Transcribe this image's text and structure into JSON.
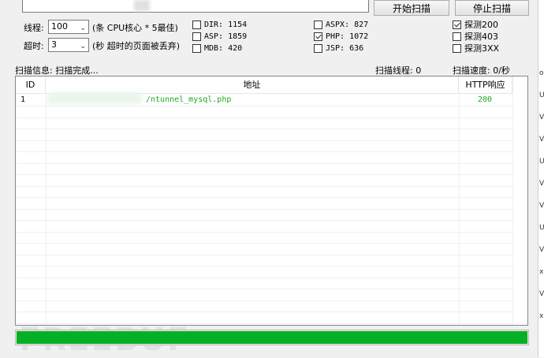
{
  "toolbar": {
    "start_label": "开始扫描",
    "stop_label": "停止扫描"
  },
  "options": {
    "threads_label": "线程:",
    "threads_value": "100",
    "threads_hint": "(条 CPU核心 * 5最佳)",
    "timeout_label": "超时:",
    "timeout_value": "3",
    "timeout_hint": "(秒 超时的页面被丢弃)"
  },
  "dicts": [
    {
      "label": "DIR: 1154",
      "checked": false
    },
    {
      "label": "ASP: 1859",
      "checked": false
    },
    {
      "label": "MDB: 420",
      "checked": false
    },
    {
      "label": "ASPX: 827",
      "checked": false
    },
    {
      "label": "PHP: 1072",
      "checked": true
    },
    {
      "label": "JSP: 636",
      "checked": false
    }
  ],
  "probes": [
    {
      "label": "探测200",
      "checked": true
    },
    {
      "label": "探测403",
      "checked": false
    },
    {
      "label": "探测3XX",
      "checked": false
    }
  ],
  "status": {
    "info": "扫描信息: 扫描完成...",
    "threads": "扫描线程: 0",
    "speed": "扫描速度: 0/秒"
  },
  "table": {
    "columns": [
      "ID",
      "地址",
      "HTTP响应"
    ],
    "rows": [
      {
        "id": "1",
        "address": "/ntunnel_mysql.php",
        "response": "200"
      }
    ]
  },
  "progress": {
    "fraction": 1.0
  },
  "colors": {
    "accent": "#06b025",
    "result_text": "#1fa81f"
  },
  "edge_chars": [
    "o",
    "U",
    "V",
    "V",
    "U",
    "V",
    "V",
    "U",
    "V",
    "x",
    "V",
    "x"
  ]
}
